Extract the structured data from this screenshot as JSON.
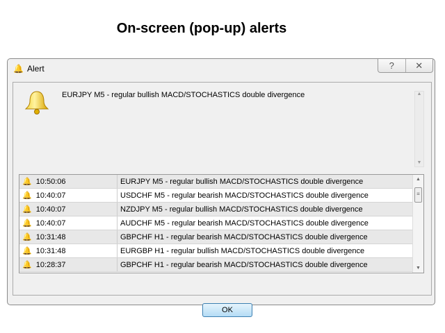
{
  "heading": "On-screen (pop-up) alerts",
  "dialog": {
    "title": "Alert",
    "help_label": "?",
    "close_label": "✕",
    "message": "EURJPY M5 - regular bullish MACD/STOCHASTICS double divergence",
    "ok_label": "OK"
  },
  "alerts": [
    {
      "time": "10:50:06",
      "text": "EURJPY M5 - regular bullish MACD/STOCHASTICS double divergence"
    },
    {
      "time": "10:40:07",
      "text": "USDCHF M5 - regular bearish MACD/STOCHASTICS double divergence"
    },
    {
      "time": "10:40:07",
      "text": "NZDJPY M5 - regular bullish MACD/STOCHASTICS double divergence"
    },
    {
      "time": "10:40:07",
      "text": "AUDCHF M5 - regular bearish MACD/STOCHASTICS double divergence"
    },
    {
      "time": "10:31:48",
      "text": "GBPCHF H1 - regular bearish MACD/STOCHASTICS double divergence"
    },
    {
      "time": "10:31:48",
      "text": "EURGBP H1 - regular bullish MACD/STOCHASTICS double divergence"
    },
    {
      "time": "10:28:37",
      "text": "GBPCHF H1 - regular bearish MACD/STOCHASTICS double divergence"
    }
  ]
}
